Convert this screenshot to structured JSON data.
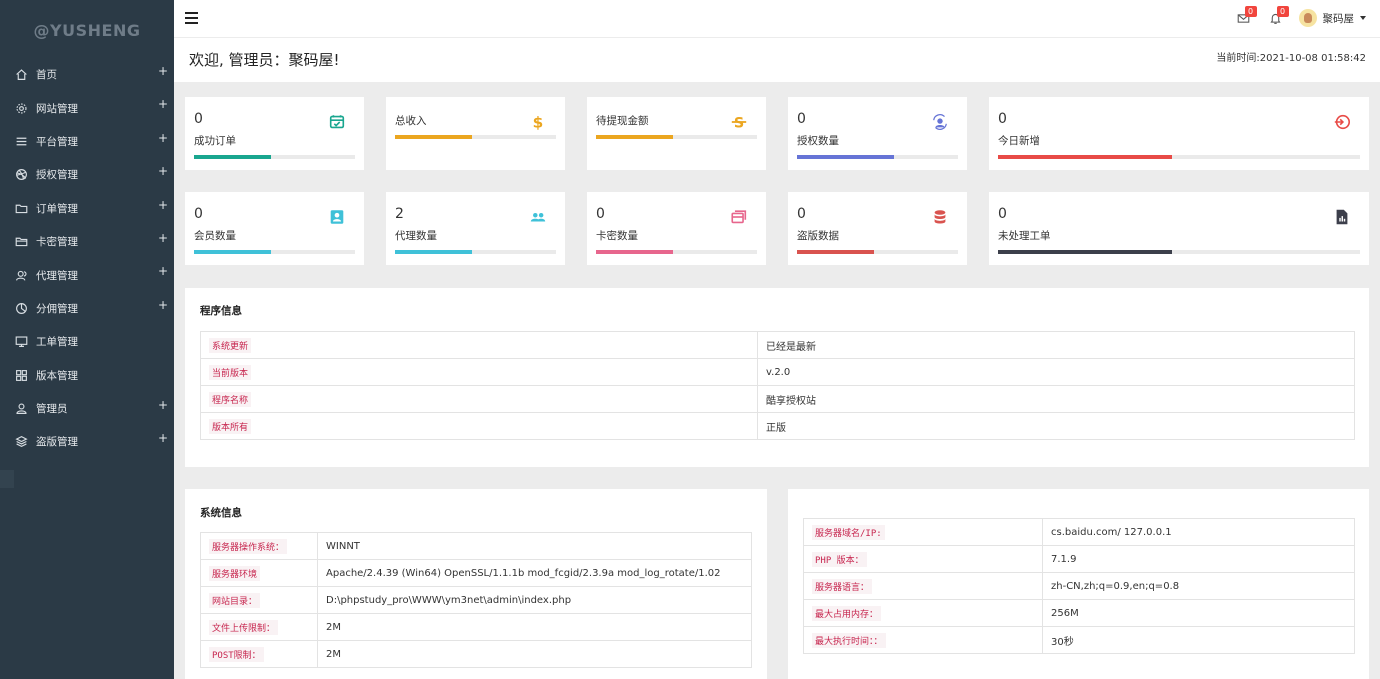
{
  "sidebar": {
    "logo": "@YUSHENG",
    "items": [
      {
        "label": "首页",
        "icon": "home-icon",
        "plus": "+"
      },
      {
        "label": "网站管理",
        "icon": "gear-icon",
        "plus": "+"
      },
      {
        "label": "平台管理",
        "icon": "list-icon",
        "plus": "+"
      },
      {
        "label": "授权管理",
        "icon": "dribbble-icon",
        "plus": "+"
      },
      {
        "label": "订单管理",
        "icon": "folder-icon",
        "plus": "+"
      },
      {
        "label": "卡密管理",
        "icon": "folder-open-icon",
        "plus": "+"
      },
      {
        "label": "代理管理",
        "icon": "user-group-icon",
        "plus": "+"
      },
      {
        "label": "分佣管理",
        "icon": "pie-icon",
        "plus": "+"
      },
      {
        "label": "工单管理",
        "icon": "monitor-icon",
        "plus": ""
      },
      {
        "label": "版本管理",
        "icon": "grid-icon",
        "plus": ""
      },
      {
        "label": "管理员",
        "icon": "user-icon",
        "plus": "+"
      },
      {
        "label": "盗版管理",
        "icon": "layers-icon",
        "plus": "+"
      }
    ]
  },
  "topbar": {
    "mail_badge": "0",
    "bell_badge": "0",
    "user_name": "聚码屋"
  },
  "welcome": {
    "text": "欢迎, 管理员：聚码屋!",
    "time": "当前时间:2021-10-08 01:58:42"
  },
  "stats": [
    {
      "value": "0",
      "label": "成功订单",
      "icon": "calendar-check-icon",
      "color": "#19a68f",
      "fill": 0.48
    },
    {
      "value": "",
      "label": "总收入",
      "icon": "dollar-icon",
      "color": "#eba620",
      "fill": 0.48
    },
    {
      "value": "",
      "label": "待提现金额",
      "icon": "strikethrough-icon",
      "color": "#eba620",
      "fill": 0.48
    },
    {
      "value": "0",
      "label": "授权数量",
      "icon": "user-sync-icon",
      "color": "#6674d6",
      "fill": 0.6
    },
    {
      "value": "0",
      "label": "今日新增",
      "icon": "login-icon",
      "color": "#e84b47",
      "fill": 0.48
    },
    {
      "value": "0",
      "label": "会员数量",
      "icon": "contact-card-icon",
      "color": "#3fc1d8",
      "fill": 0.48
    },
    {
      "value": "2",
      "label": "代理数量",
      "icon": "users-icon",
      "color": "#3fc1d8",
      "fill": 0.48
    },
    {
      "value": "0",
      "label": "卡密数量",
      "icon": "cards-icon",
      "color": "#e7668d",
      "fill": 0.48
    },
    {
      "value": "0",
      "label": "盗版数据",
      "icon": "database-icon",
      "color": "#d9534f",
      "fill": 0.48
    },
    {
      "value": "0",
      "label": "未处理工单",
      "icon": "report-icon",
      "color": "#3c3f4b",
      "fill": 0.48
    }
  ],
  "program_info": {
    "title": "程序信息",
    "rows": [
      {
        "key": "系统更新",
        "value": "已经是最新"
      },
      {
        "key": "当前版本",
        "value": "v.2.0"
      },
      {
        "key": "程序名称",
        "value": "酷享授权站"
      },
      {
        "key": "版本所有",
        "value": "正版"
      }
    ]
  },
  "system_info": {
    "title": "系统信息",
    "rows": [
      {
        "key": "服务器操作系统：",
        "value": "WINNT"
      },
      {
        "key": "服务器环境",
        "value": "Apache/2.4.39 (Win64) OpenSSL/1.1.1b mod_fcgid/2.3.9a mod_log_rotate/1.02"
      },
      {
        "key": "网站目录：",
        "value": "D:\\phpstudy_pro\\WWW\\ym3net\\admin\\index.php"
      },
      {
        "key": "文件上传限制：",
        "value": "2M"
      },
      {
        "key": "POST限制：",
        "value": "2M"
      }
    ]
  },
  "server_info": {
    "rows": [
      {
        "key": "服务器域名/IP:",
        "value": "cs.baidu.com/ 127.0.0.1"
      },
      {
        "key": "PHP 版本：",
        "value": "7.1.9"
      },
      {
        "key": "服务器语言：",
        "value": "zh-CN,zh;q=0.9,en;q=0.8"
      },
      {
        "key": "最大占用内存：",
        "value": "256M"
      },
      {
        "key": "最大执行时间：：",
        "value": "30秒"
      }
    ]
  }
}
